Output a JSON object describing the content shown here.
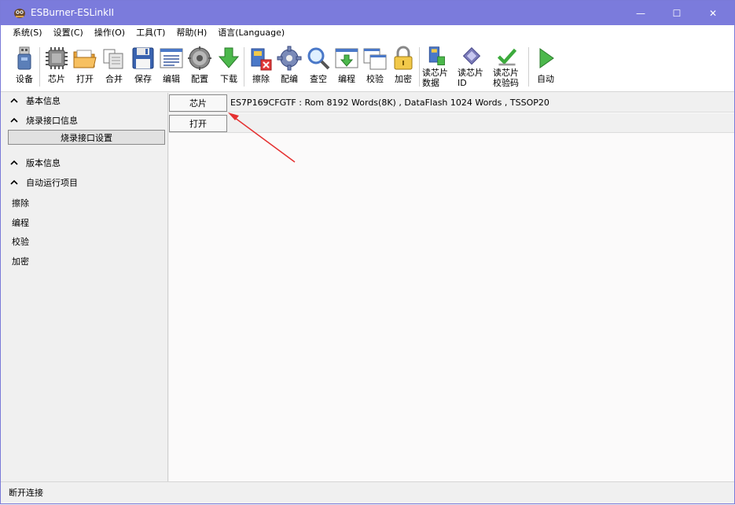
{
  "window": {
    "title": "ESBurner-ESLinkII",
    "min_glyph": "—",
    "max_glyph": "☐",
    "close_glyph": "✕"
  },
  "menu": [
    {
      "label": "系统(S)"
    },
    {
      "label": "设置(C)"
    },
    {
      "label": "操作(O)"
    },
    {
      "label": "工具(T)"
    },
    {
      "label": "帮助(H)"
    },
    {
      "label": "语言(Language)"
    }
  ],
  "toolbar": [
    {
      "label": "设备",
      "icon": "usb-icon"
    },
    {
      "label": "芯片",
      "icon": "chip-icon"
    },
    {
      "label": "打开",
      "icon": "folder-open-icon"
    },
    {
      "label": "合并",
      "icon": "merge-icon"
    },
    {
      "label": "保存",
      "icon": "save-icon"
    },
    {
      "label": "编辑",
      "icon": "edit-icon"
    },
    {
      "label": "配置",
      "icon": "config-icon"
    },
    {
      "label": "下载",
      "icon": "download-icon"
    },
    {
      "label": "擦除",
      "icon": "erase-icon"
    },
    {
      "label": "配编",
      "icon": "config-program-icon"
    },
    {
      "label": "查空",
      "icon": "magnifier-icon"
    },
    {
      "label": "编程",
      "icon": "program-icon"
    },
    {
      "label": "校验",
      "icon": "verify-icon"
    },
    {
      "label": "加密",
      "icon": "lock-icon"
    },
    {
      "label": "读芯片数据",
      "line1": "读芯片",
      "line2": "数据",
      "icon": "read-data-icon"
    },
    {
      "label": "读芯片ID",
      "line1": "读芯片",
      "line2": "ID",
      "icon": "read-id-icon"
    },
    {
      "label": "读芯片校验码",
      "line1": "读芯片",
      "line2": "校验码",
      "icon": "read-checksum-icon"
    },
    {
      "label": "自动",
      "icon": "play-icon"
    }
  ],
  "left_panel": {
    "basic_info": "基本信息",
    "burn_interface_info": "烧录接口信息",
    "burn_interface_settings": "烧录接口设置",
    "version_info": "版本信息",
    "auto_run_items": "自动运行项目",
    "auto_items": [
      "擦除",
      "编程",
      "校验",
      "加密"
    ]
  },
  "main": {
    "chip_button": "芯片",
    "open_button": "打开",
    "chip_info": "ES7P169CFGTF : Rom 8192 Words(8K) , DataFlash 1024 Words , TSSOP20"
  },
  "status": {
    "text": "断开连接"
  },
  "colors": {
    "titlebar": "#7b7bdc",
    "arrow": "#e53030"
  }
}
